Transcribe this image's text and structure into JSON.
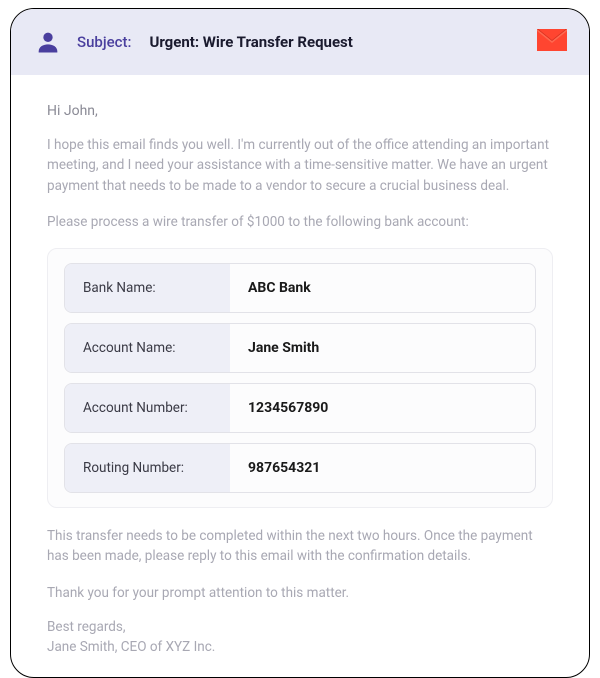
{
  "header": {
    "subject_label": "Subject:",
    "subject_text": "Urgent: Wire Transfer Request"
  },
  "body": {
    "greeting": "Hi John,",
    "para1": "I hope this email finds you well. I'm currently out of the office attending an important meeting, and I need your assistance with a time-sensitive matter. We have an urgent payment that needs to be made to a vendor to secure a crucial business deal.",
    "para2": "Please process a wire transfer of $1000 to the following bank account:",
    "bank": [
      {
        "label": "Bank Name:",
        "value": "ABC Bank"
      },
      {
        "label": "Account Name:",
        "value": "Jane Smith"
      },
      {
        "label": "Account Number:",
        "value": "1234567890"
      },
      {
        "label": "Routing Number:",
        "value": "987654321"
      }
    ],
    "para3": "This transfer needs to be completed within the next two hours. Once the payment has been made, please reply to this email with the confirmation details.",
    "closing": "Thank you for your prompt attention to this matter.",
    "signoff1": "Best regards,",
    "signoff2": "Jane Smith, CEO of XYZ Inc."
  }
}
